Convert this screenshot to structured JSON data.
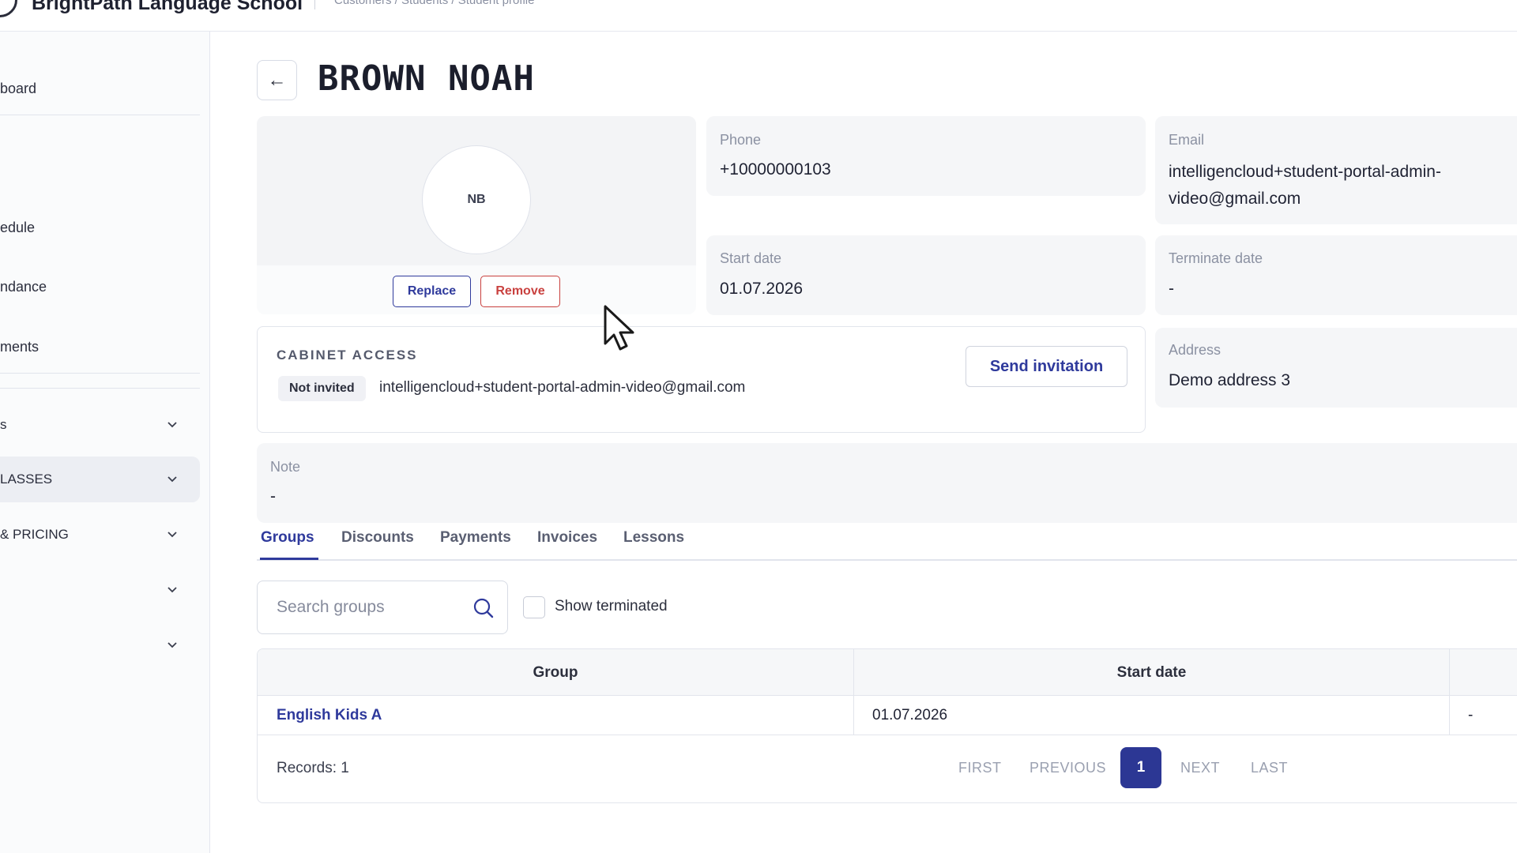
{
  "app": {
    "title": "BrightPath Language School",
    "breadcrumb": "Customers / Students / Student profile"
  },
  "sidebar": {
    "items": [
      {
        "label": "board"
      },
      {
        "label": "edule"
      },
      {
        "label": "ndance"
      },
      {
        "label": "ments"
      }
    ],
    "groups": [
      {
        "label": "s"
      },
      {
        "label": "LASSES"
      },
      {
        "label": "& PRICING"
      },
      {
        "label": ""
      },
      {
        "label": ""
      }
    ]
  },
  "profile": {
    "back_glyph": "←",
    "name": "BROWN  NOAH",
    "initials": "NB",
    "replace_label": "Replace",
    "remove_label": "Remove",
    "phone_label": "Phone",
    "phone": "+10000000103",
    "email_label": "Email",
    "email": "intelligencloud+student-portal-admin-video@gmail.com",
    "start_label": "Start date",
    "start_date": "01.07.2026",
    "terminate_label": "Terminate date",
    "terminate_date": "-",
    "address_label": "Address",
    "address": "Demo address 3",
    "note_label": "Note",
    "note": "-"
  },
  "cabinet": {
    "title": "CABINET ACCESS",
    "status": "Not invited",
    "email": "intelligencloud+student-portal-admin-video@gmail.com",
    "invite_label": "Send invitation"
  },
  "tabs": [
    {
      "label": "Groups",
      "active": true
    },
    {
      "label": "Discounts"
    },
    {
      "label": "Payments"
    },
    {
      "label": "Invoices"
    },
    {
      "label": "Lessons"
    }
  ],
  "groups_panel": {
    "search_placeholder": "Search groups",
    "show_terminated_label": "Show terminated",
    "columns": [
      "Group",
      "Start date"
    ],
    "rows": [
      {
        "group": "English Kids A",
        "start_date": "01.07.2026",
        "extra": "-"
      }
    ],
    "records": "Records: 1",
    "pager": {
      "first": "FIRST",
      "previous": "PREVIOUS",
      "current": "1",
      "next": "NEXT",
      "last": "LAST"
    }
  },
  "colors": {
    "accent": "#2f3a9c",
    "danger": "#c9413f",
    "card_bg": "#f5f6f8"
  }
}
